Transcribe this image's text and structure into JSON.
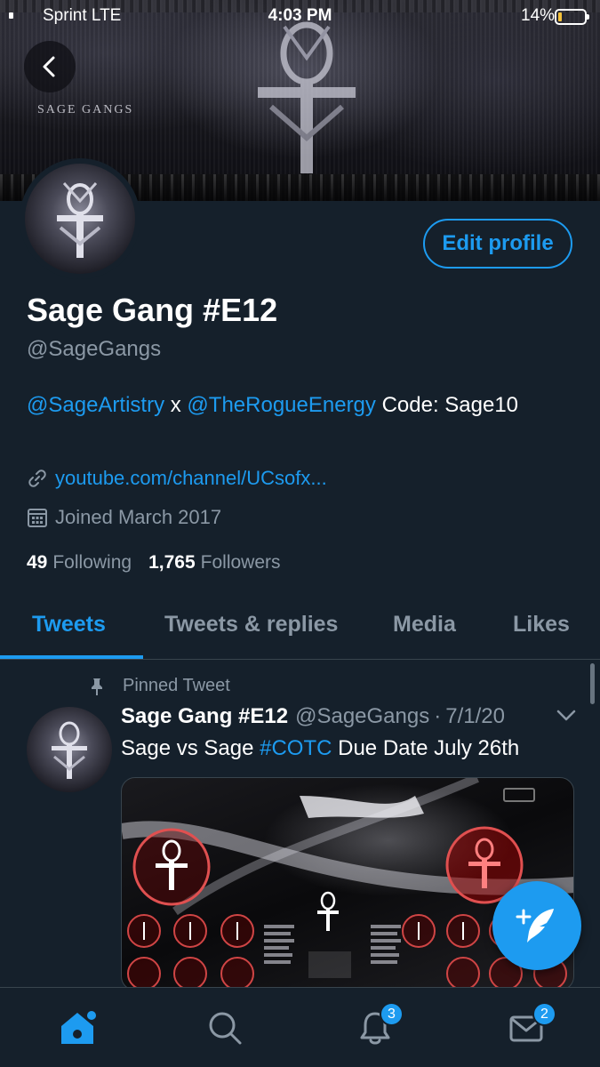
{
  "status_bar": {
    "carrier": "Sprint LTE",
    "time": "4:03 PM",
    "battery": "14%",
    "battery_level": 0.14
  },
  "banner": {
    "text": "SAGE GANGS"
  },
  "header": {
    "back_icon": "chevron-left-icon"
  },
  "profile": {
    "edit_label": "Edit profile",
    "display_name": "Sage Gang #E12",
    "handle": "@SageGangs",
    "bio": {
      "mention1": "@SageArtistry",
      "sep": " x ",
      "mention2": "@TheRogueEnergy",
      "rest": " Code: Sage10"
    },
    "link": "youtube.com/channel/UCsofx...",
    "joined": "Joined March 2017",
    "following_count": "49",
    "following_label": "Following",
    "followers_count": "1,765",
    "followers_label": "Followers"
  },
  "tabs": [
    {
      "label": "Tweets",
      "active": true
    },
    {
      "label": "Tweets & replies",
      "active": false
    },
    {
      "label": "Media",
      "active": false
    },
    {
      "label": "Likes",
      "active": false
    }
  ],
  "tweet": {
    "pinned_label": "Pinned Tweet",
    "name": "Sage Gang #E12",
    "handle": "@SageGangs",
    "dot": "·",
    "date": "7/1/20",
    "text_before": "Sage vs Sage ",
    "hashtag": "#COTC",
    "text_after": " Due Date July 26th"
  },
  "bottom_nav": {
    "notifications_badge": "3",
    "messages_badge": "2"
  },
  "colors": {
    "background": "#15202b",
    "accent": "#1d9bf0",
    "secondary_text": "#8b98a5",
    "border": "#38444d"
  }
}
